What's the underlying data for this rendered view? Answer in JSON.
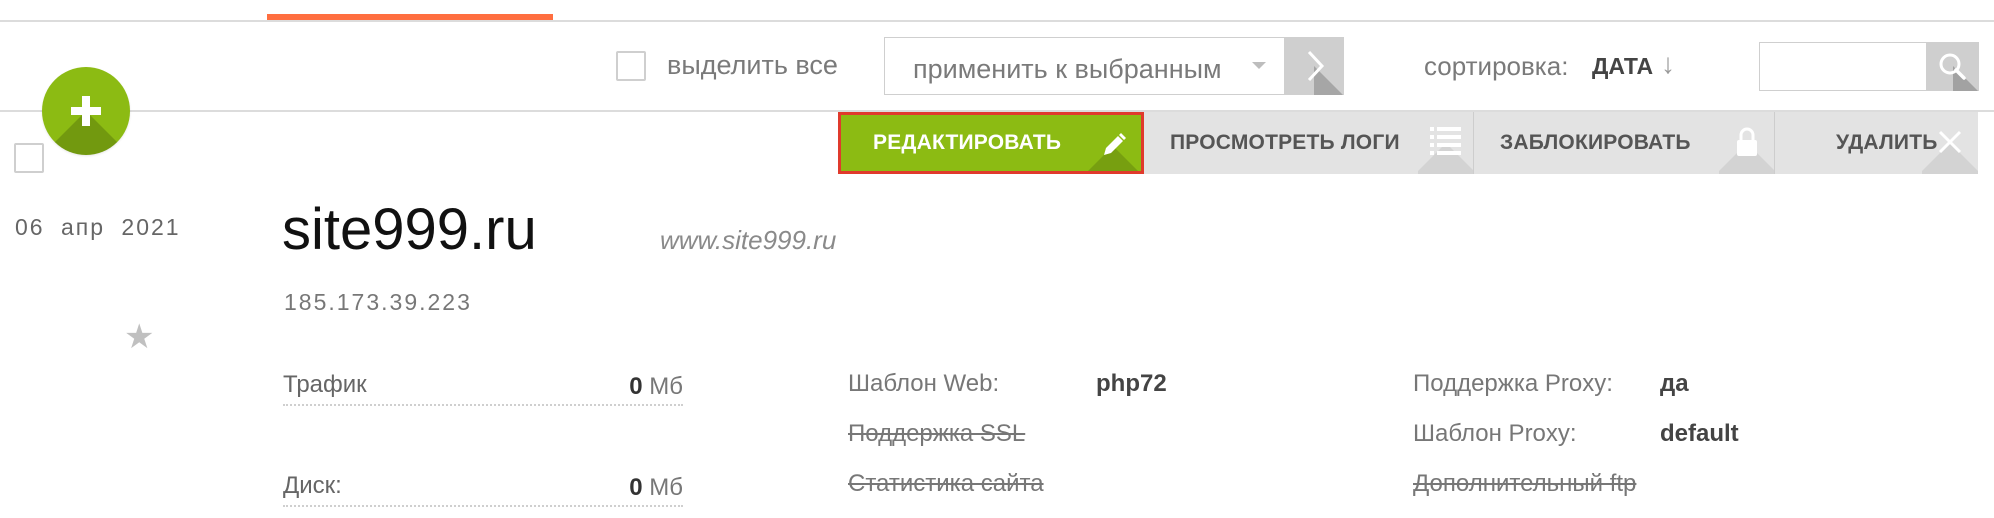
{
  "toolbar": {
    "select_all_label": "выделить все",
    "bulk_action_placeholder": "применить к выбранным",
    "sort_label": "сортировка:",
    "sort_value": "ДАТА",
    "sort_direction_glyph": "↓",
    "search_value": ""
  },
  "actions": {
    "edit": "РЕДАКТИРОВАТЬ",
    "logs": "ПРОСМОТРЕТЬ ЛОГИ",
    "block": "ЗАБЛОКИРОВАТЬ",
    "delete": "УДАЛИТЬ"
  },
  "item": {
    "date": "06 апр 2021",
    "domain": "site999.ru",
    "url": "www.site999.ru",
    "ip": "185.173.39.223",
    "stats": [
      {
        "label": "Трафик",
        "value": "0",
        "unit": "Мб"
      },
      {
        "label": "Диск:",
        "value": "0",
        "unit": "Мб"
      }
    ],
    "params_middle": [
      {
        "label": "Шаблон Web:",
        "value": "php72",
        "enabled": true
      },
      {
        "label": "Поддержка SSL",
        "value": "",
        "enabled": false
      },
      {
        "label": "Статистика сайта",
        "value": "",
        "enabled": false
      }
    ],
    "params_right": [
      {
        "label": "Поддержка Proxy:",
        "value": "да",
        "enabled": true
      },
      {
        "label": "Шаблон Proxy:",
        "value": "default",
        "enabled": true
      },
      {
        "label": "Дополнительный ftp",
        "value": "",
        "enabled": false
      }
    ]
  },
  "colors": {
    "accent": "#8cbb13",
    "tab_indicator": "#ff6e40",
    "edit_highlight_border": "#e03a2c"
  },
  "icons": {
    "add": "plus-icon",
    "apply": "chevron-right-icon",
    "search": "search-icon",
    "edit": "pencil-icon",
    "logs": "list-icon",
    "block": "lock-icon",
    "delete": "close-icon",
    "favorite": "star-icon"
  }
}
